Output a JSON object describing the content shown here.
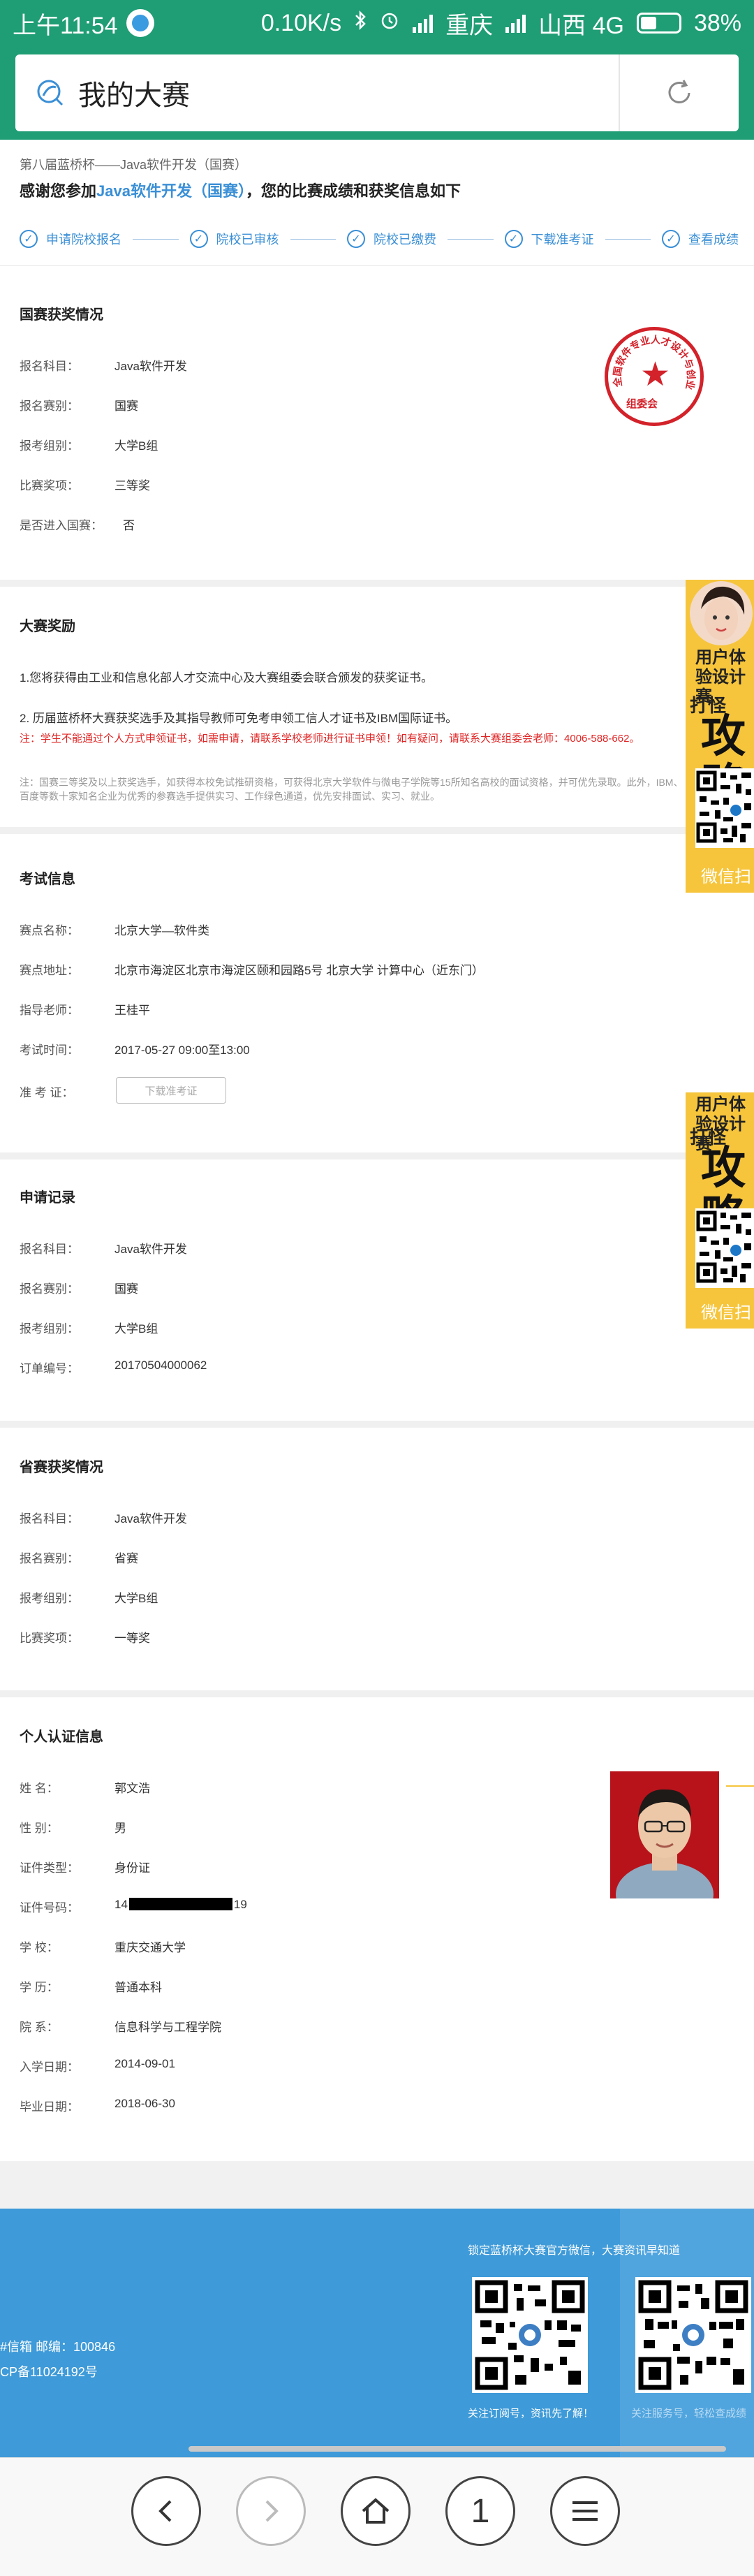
{
  "status_bar": {
    "time": "上午11:54",
    "net_speed": "0.10K/s",
    "carrier1": "重庆",
    "carrier2": "山西 4G",
    "battery": "38%"
  },
  "browser": {
    "title": "我的大赛"
  },
  "header": {
    "breadcrumb": "第八届蓝桥杯——Java软件开发（国赛）",
    "thanks_prefix": "感谢您参加",
    "thanks_highlight": "Java软件开发（国赛）",
    "thanks_suffix": "，您的比赛成绩和获奖信息如下"
  },
  "steps": [
    {
      "label": "申请院校报名"
    },
    {
      "label": "院校已审核"
    },
    {
      "label": "院校已缴费"
    },
    {
      "label": "下载准考证"
    },
    {
      "label": "查看成绩"
    }
  ],
  "national_award": {
    "title": "国赛获奖情况",
    "rows": [
      {
        "label": "报名科目：",
        "value": "Java软件开发"
      },
      {
        "label": "报名赛别：",
        "value": "国赛"
      },
      {
        "label": "报考组别：",
        "value": "大学B组"
      },
      {
        "label": "比赛奖项：",
        "value": "三等奖"
      },
      {
        "label": "是否进入国赛：",
        "value": "否"
      }
    ],
    "seal_text": "全国软件专业人才设计与创业大赛",
    "seal_bottom": "组委会"
  },
  "award_info": {
    "title": "大赛奖励",
    "p1": "1.您将获得由工业和信息化部人才交流中心及大赛组委会联合颁发的获奖证书。",
    "p2": "2. 历届蓝桥杯大赛获奖选手及其指导教师可免考申领工信人才证书及IBM国际证书。",
    "note_red": "注：学生不能通过个人方式申领证书，如需申请，请联系学校老师进行证书申领！如有疑问，请联系大赛组委会老师：4006-588-662。",
    "note_grey": "注：国赛三等奖及以上获奖选手，如获得本校免试推研资格，可获得北京大学软件与微电子学院等15所知名高校的面试资格，并可优先录取。此外，IBM、百度等数十家知名企业为优秀的参赛选手提供实习、工作绿色通道，优先安排面试、实习、就业。"
  },
  "exam_info": {
    "title": "考试信息",
    "rows": [
      {
        "label": "赛点名称：",
        "value": "北京大学—软件类"
      },
      {
        "label": "赛点地址：",
        "value": "北京市海淀区北京市海淀区颐和园路5号 北京大学 计算中心（近东门）"
      },
      {
        "label": "指导老师：",
        "value": "王桂平"
      },
      {
        "label": "考试时间：",
        "value": "2017-05-27 09:00至13:00"
      },
      {
        "label": "准 考 证：",
        "value": ""
      }
    ],
    "download_button": "下载准考证"
  },
  "application": {
    "title": "申请记录",
    "rows": [
      {
        "label": "报名科目：",
        "value": "Java软件开发"
      },
      {
        "label": "报名赛别：",
        "value": "国赛"
      },
      {
        "label": "报考组别：",
        "value": "大学B组"
      },
      {
        "label": "订单编号：",
        "value": "20170504000062"
      }
    ]
  },
  "provincial_award": {
    "title": "省赛获奖情况",
    "rows": [
      {
        "label": "报名科目：",
        "value": "Java软件开发"
      },
      {
        "label": "报名赛别：",
        "value": "省赛"
      },
      {
        "label": "报考组别：",
        "value": "大学B组"
      },
      {
        "label": "比赛奖项：",
        "value": "一等奖"
      }
    ]
  },
  "personal": {
    "title": "个人认证信息",
    "rows": [
      {
        "label": "姓      名：",
        "value": "郭文浩"
      },
      {
        "label": "性      别：",
        "value": "男"
      },
      {
        "label": "证件类型：",
        "value": "身份证"
      },
      {
        "label": "证件号码：",
        "value": "14"
      },
      {
        "label": "学      校：",
        "value": "重庆交通大学"
      },
      {
        "label": "学      历：",
        "value": "普通本科"
      },
      {
        "label": "院      系：",
        "value": "信息科学与工程学院"
      },
      {
        "label": "入学日期：",
        "value": "2014-09-01"
      },
      {
        "label": "毕业日期：",
        "value": "2018-06-30"
      }
    ],
    "id_suffix": "19"
  },
  "side_ads": {
    "ad1_top": "用户体验设计赛",
    "ad1_mid": "打怪",
    "ad1_bottom": "微信扫",
    "ad2_top": "用户体验设计赛",
    "ad2_mid": "打怪",
    "ad2_bottom": "微信扫",
    "ad_big_glyph": "攻略"
  },
  "footer": {
    "follow": "锁定蓝桥杯大赛官方微信，大赛资讯早知道",
    "mail": "#信箱  邮编：100846",
    "icp": "CP备11024192号",
    "caption1": "关注订阅号，资讯先了解！",
    "caption2": "关注服务号，轻松查成绩"
  },
  "nav": {
    "tab_count": "1"
  },
  "colors": {
    "brand_green": "#1f9d74",
    "link_blue": "#3a8fd6",
    "footer_blue": "#3e9ad8",
    "seal_red": "#d3222a",
    "ad_yellow": "#f6c53c"
  }
}
